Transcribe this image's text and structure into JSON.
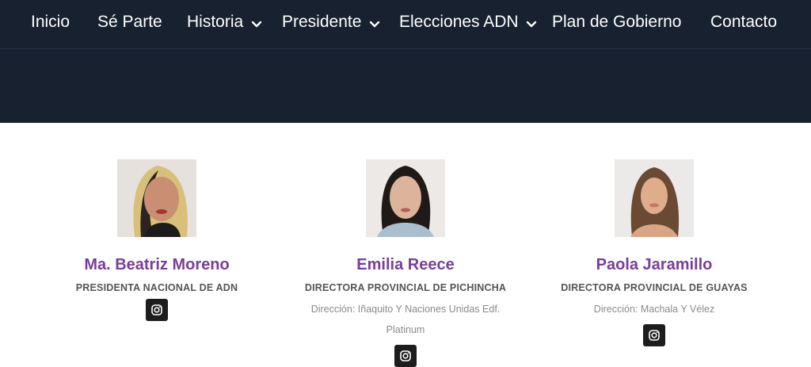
{
  "nav": {
    "items": [
      {
        "label": "Inicio",
        "has_caret": false
      },
      {
        "label": "Sé Parte",
        "has_caret": false
      },
      {
        "label": "Historia",
        "has_caret": true
      },
      {
        "label": "Presidente",
        "has_caret": true
      },
      {
        "label": "Elecciones ADN",
        "has_caret": true
      },
      {
        "label": "Plan de Gobierno",
        "has_caret": false
      },
      {
        "label": "Contacto",
        "has_caret": false
      }
    ]
  },
  "members": [
    {
      "name": "Ma. Beatriz Moreno",
      "role": "PRESIDENTA NACIONAL DE ADN",
      "address": ""
    },
    {
      "name": "Emilia Reece",
      "role": "DIRECTORA PROVINCIAL DE PICHINCHA",
      "address": "Dirección: Iñaquito Y Naciones Unidas Edf. Platinum"
    },
    {
      "name": "Paola Jaramillo",
      "role": "DIRECTORA PROVINCIAL DE GUAYAS",
      "address": "Dirección: Machala Y Vélez"
    }
  ],
  "colors": {
    "header_bg": "#172130",
    "name_color": "#7a3d9a",
    "icon_button_bg": "#1d1d1d"
  },
  "icons": {
    "social": "instagram-icon",
    "dropdown": "chevron-down-icon"
  }
}
